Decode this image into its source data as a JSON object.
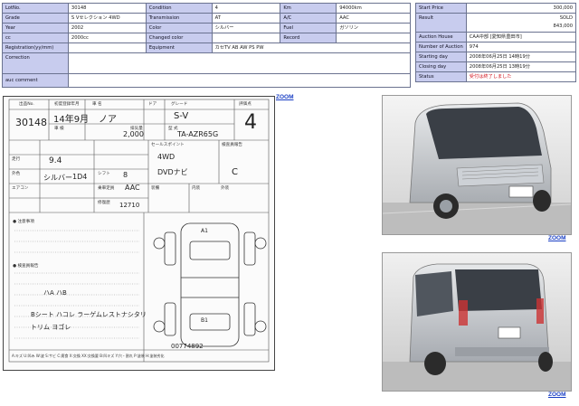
{
  "lot_table": {
    "rows": [
      {
        "cells": [
          {
            "label": "LotNo.",
            "value": "30148"
          },
          {
            "label": "Condition",
            "value": "4"
          },
          {
            "label": "Km",
            "value": "94000km"
          }
        ]
      },
      {
        "cells": [
          {
            "label": "Grade",
            "value": "S Vセレクション 4WD"
          },
          {
            "label": "Transmission",
            "value": "AT"
          },
          {
            "label": "A/C",
            "value": "AAC"
          }
        ]
      },
      {
        "cells": [
          {
            "label": "Year",
            "value": "2002"
          },
          {
            "label": "Color",
            "value": "シルバー"
          },
          {
            "label": "Fuel",
            "value": "ガソリン"
          }
        ]
      },
      {
        "cells": [
          {
            "label": "cc",
            "value": "2000cc"
          },
          {
            "label": "Changed color",
            "value": ""
          },
          {
            "label": "Record",
            "value": ""
          }
        ]
      }
    ],
    "registration": {
      "label": "Registration(yy/mm)",
      "value": ""
    },
    "equipment": {
      "label": "Equipment",
      "value": "カセTV AB AW PS PW"
    },
    "correction": {
      "label": "Correction",
      "value": ""
    },
    "comment": {
      "label": "auc comment",
      "value": ""
    }
  },
  "price_table": {
    "start_price": {
      "label": "Start Price",
      "value": "300,000"
    },
    "result": {
      "label": "Result",
      "value": "SOLD",
      "price": "843,000"
    },
    "auction_house": {
      "label": "Auction House",
      "value": "CAA中部 [愛知県豊田市]"
    },
    "auctions": {
      "label": "Number of Auction",
      "value": "974"
    },
    "starting_day": {
      "label": "Starting day",
      "value": "2008年06月25日 14時19分"
    },
    "closing_day": {
      "label": "Closing day",
      "value": "2008年06月25日 13時19分"
    },
    "status": {
      "label": "Status",
      "value": "受付は終了しました"
    }
  },
  "zoom_label": "ZOOM",
  "sheet": {
    "lot_no": "30148",
    "year_month": "14年9月",
    "model": "ノア",
    "grade": "S-V",
    "score": "4",
    "cc": "2,000",
    "chassis": "TA-AZR65G",
    "mileage": "9.4",
    "color": "シルバー",
    "color_code": "1D4",
    "drive": "4WD",
    "options": "DVDナビ",
    "ac": "AAC",
    "shift": "C",
    "seat": "8",
    "odometer": "12710",
    "notes1": "ハA   ハB",
    "notes2": "Bシート ハコレ  ラーゲムレストナシタリ",
    "notes3": "トリム ヨゴレ",
    "notes4": "00774892",
    "mark_a1": "A1",
    "mark_b1": "B1",
    "hdr_lot": "出品No.",
    "hdr_reg": "初度登録年月",
    "hdr_name": "車 名",
    "hdr_doors": "ドア",
    "hdr_grade": "グレード",
    "hdr_score": "評価点",
    "hdr_cc": "排気量",
    "hdr_shaken": "車 検",
    "hdr_model": "型 式",
    "hdr_mileage": "走行",
    "hdr_color": "外色",
    "hdr_ac": "エアコン",
    "hdr_shift": "シフト",
    "hdr_seat": "乗車定員",
    "hdr_points": "セールスポイント",
    "hdr_inspector": "検査員報告",
    "hdr_equip": "装備",
    "hdr_inner": "内装",
    "hdr_outer": "外装",
    "hdr_history": "修復歴",
    "hdr_notes": "● 注意事項",
    "hdr_points2": "● 検査員報告",
    "footer": "A:キズ U:凹み W:波 S:サビ C:腐食 X:交換 XX:交換要 B:凹キズ Y:穴・割れ P:塗装 H:塗装劣化"
  }
}
